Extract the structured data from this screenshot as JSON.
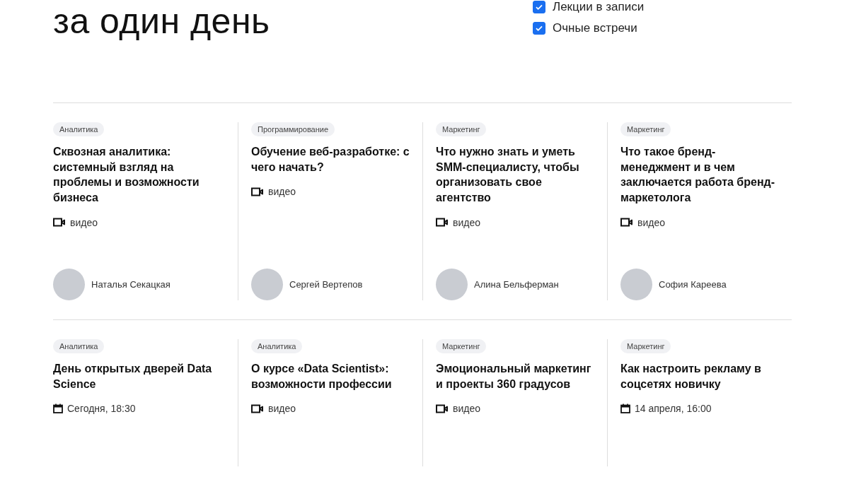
{
  "heading": "за один день",
  "filters": [
    {
      "label": "Лекции в записи",
      "checked": true
    },
    {
      "label": "Очные встречи",
      "checked": true
    }
  ],
  "rows": [
    {
      "cards": [
        {
          "tag": "Аналитика",
          "title": "Сквозная аналитика: системный взгляд на проблемы и возможности бизнеса",
          "meta": {
            "kind": "video",
            "text": "видео"
          },
          "author": "Наталья Секацкая"
        },
        {
          "tag": "Программирование",
          "title": "Обучение веб-разработке: с чего начать?",
          "meta": {
            "kind": "video",
            "text": "видео"
          },
          "author": "Сергей Вертепов"
        },
        {
          "tag": "Маркетинг",
          "title": "Что нужно знать и уметь SMM-специалисту, чтобы организовать свое агентство",
          "meta": {
            "kind": "video",
            "text": "видео"
          },
          "author": "Алина Бельферман"
        },
        {
          "tag": "Маркетинг",
          "title": "Что такое бренд-менеджмент и в чем заключается работа бренд-маркетолога",
          "meta": {
            "kind": "video",
            "text": "видео"
          },
          "author": "София Кареева"
        }
      ]
    },
    {
      "cards": [
        {
          "tag": "Аналитика",
          "title": "День открытых дверей Data Science",
          "meta": {
            "kind": "date",
            "text": "Сегодня, 18:30"
          }
        },
        {
          "tag": "Аналитика",
          "title": "О курсе «Data Scientist»: возможности профессии",
          "meta": {
            "kind": "video",
            "text": "видео"
          }
        },
        {
          "tag": "Маркетинг",
          "title": "Эмоциональный маркетинг и проекты 360 градусов",
          "meta": {
            "kind": "video",
            "text": "видео"
          }
        },
        {
          "tag": "Маркетинг",
          "title": "Как настроить рекламу в соцсетях новичку",
          "meta": {
            "kind": "date",
            "text": "14 апреля, 16:00"
          }
        }
      ]
    }
  ]
}
